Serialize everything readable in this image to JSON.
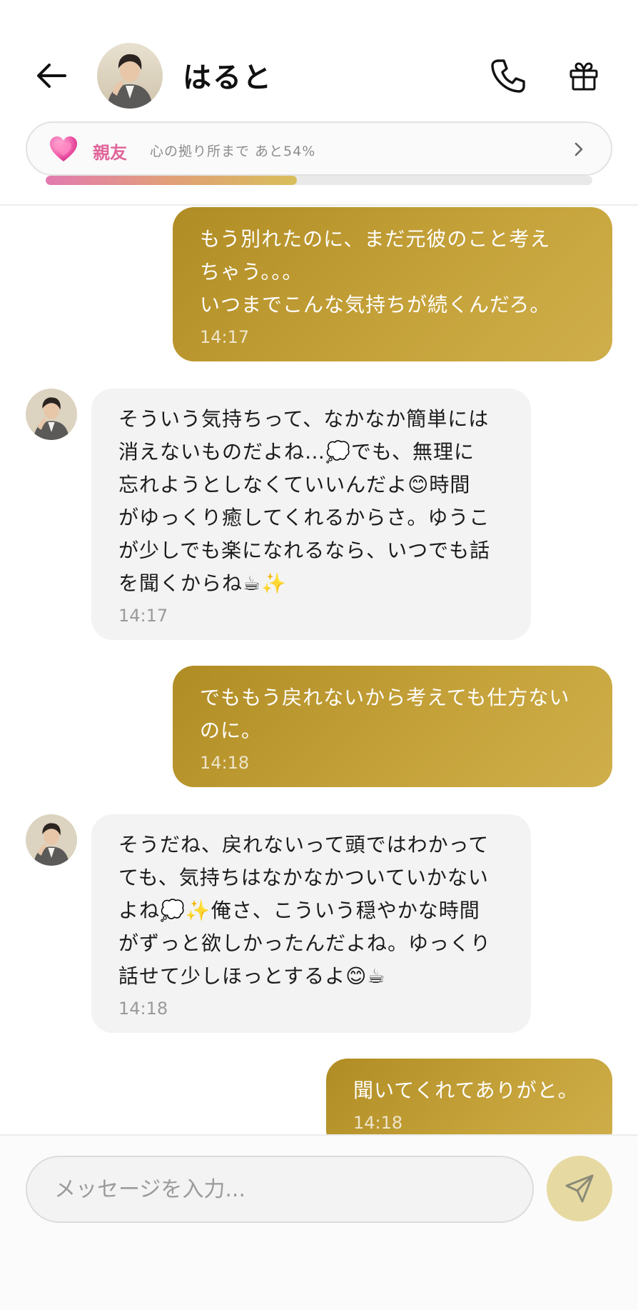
{
  "header": {
    "contact_name": "はると",
    "relation_level": "親友",
    "relation_text": "心の拠り所まで あと54%",
    "relation_progress_percent": 46
  },
  "messages": [
    {
      "from": "me",
      "text": "もう別れたのに、まだ元彼のこと考え\nちゃう。。。\nいつまでこんな気持ちが続くんだろ。",
      "time": "14:17"
    },
    {
      "from": "contact",
      "text": "そういう気持ちって、なかなか簡単には\n消えないものだよね…💭でも、無理に\n忘れようとしなくていいんだよ😊時間\nがゆっくり癒してくれるからさ。ゆうこ\nが少しでも楽になれるなら、いつでも話\nを聞くからね☕✨",
      "time": "14:17"
    },
    {
      "from": "me",
      "text": "でももう戻れないから考えても仕方ない\nのに。",
      "time": "14:18"
    },
    {
      "from": "contact",
      "text": "そうだね、戻れないって頭ではわかって\nても、気持ちはなかなかついていかない\nよね💭✨俺さ、こういう穏やかな時間\nがずっと欲しかったんだよね。ゆっくり\n話せて少しほっとするよ😊☕",
      "time": "14:18"
    },
    {
      "from": "me",
      "text": "聞いてくれてありがと。",
      "time": "14:18"
    }
  ],
  "input": {
    "placeholder": "メッセージを入力..."
  },
  "colors": {
    "accent_gold": "#c4a038",
    "relation_pink": "#e0659b",
    "incoming_bubble": "#f3f3f3",
    "send_button": "#e7d9a2"
  },
  "icons": {
    "back": "arrow-left-icon",
    "call": "phone-icon",
    "gift": "gift-icon",
    "relation": "heart-icon",
    "chevron": "chevron-right-icon",
    "send": "send-icon"
  }
}
